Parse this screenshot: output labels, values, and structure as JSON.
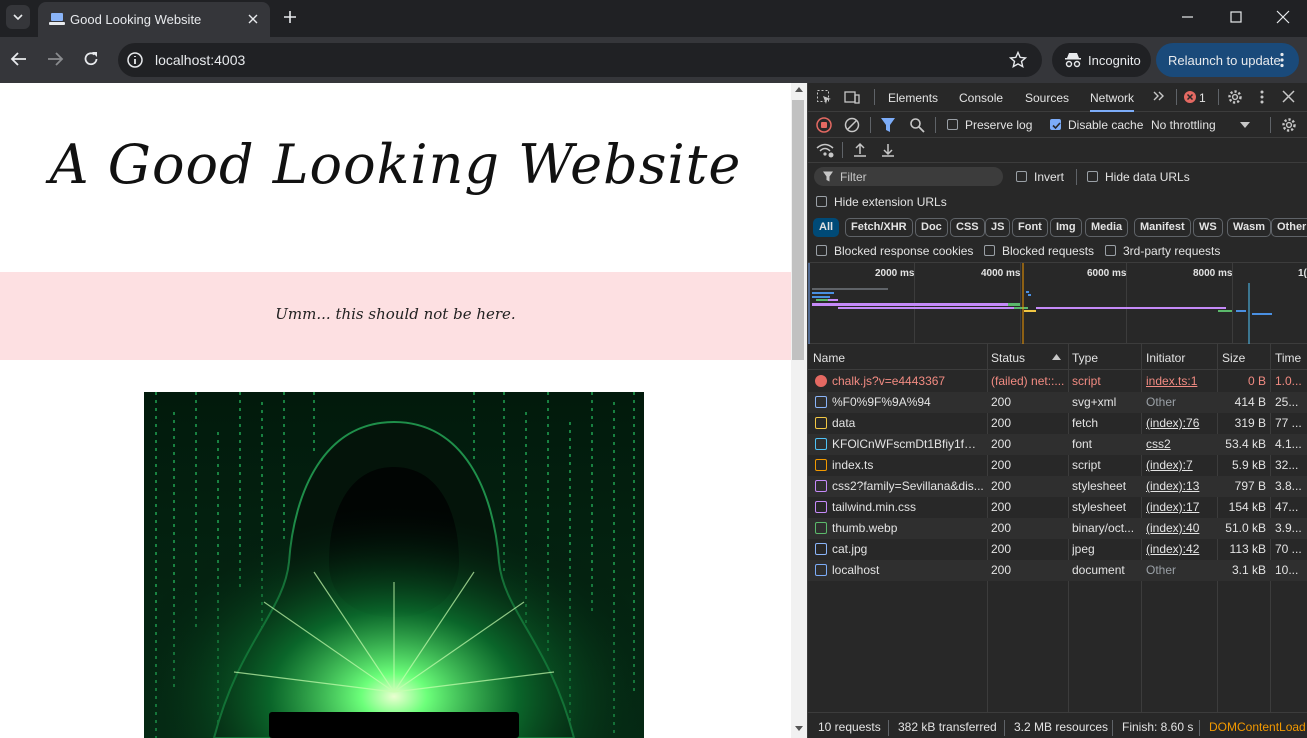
{
  "browser": {
    "tab_title": "Good Looking Website",
    "url": "localhost:4003",
    "incognito_label": "Incognito",
    "relaunch_label": "Relaunch to update"
  },
  "page": {
    "title": "A Good Looking Website",
    "notice": "Umm... this should not be here."
  },
  "devtools": {
    "tabs": [
      "Elements",
      "Console",
      "Sources",
      "Network"
    ],
    "active_tab": "Network",
    "error_count": "1",
    "preserve_log": "Preserve log",
    "disable_cache": "Disable cache",
    "throttling": "No throttling",
    "filter_placeholder": "Filter",
    "invert": "Invert",
    "hide_data_urls": "Hide data URLs",
    "hide_extension_urls": "Hide extension URLs",
    "type_filters": [
      "All",
      "Fetch/XHR",
      "Doc",
      "CSS",
      "JS",
      "Font",
      "Img",
      "Media",
      "Manifest",
      "WS",
      "Wasm",
      "Other"
    ],
    "blocked_cookies": "Blocked response cookies",
    "blocked_requests": "Blocked requests",
    "third_party": "3rd-party requests",
    "timeline_ticks": [
      "2000 ms",
      "4000 ms",
      "6000 ms",
      "8000 ms",
      "1("
    ],
    "columns": [
      "Name",
      "Status",
      "Type",
      "Initiator",
      "Size",
      "Time"
    ],
    "requests": [
      {
        "name": "chalk.js?v=e4443367",
        "status": "(failed) net::...",
        "type": "script",
        "initiator": "index.ts:1",
        "size": "0 B",
        "time": "1.0...",
        "icon": "error-icon",
        "failed": true
      },
      {
        "name": "%F0%9F%9A%94",
        "status": "200",
        "type": "svg+xml",
        "initiator": "Other",
        "size": "414 B",
        "time": "25...",
        "icon": "image-icon"
      },
      {
        "name": "data",
        "status": "200",
        "type": "fetch",
        "initiator": "(index):76",
        "size": "319 B",
        "time": "77 ...",
        "icon": "fetch-icon"
      },
      {
        "name": "KFOlCnWFscmDt1Bfiy1fBB...",
        "status": "200",
        "type": "font",
        "initiator": "css2",
        "size": "53.4 kB",
        "time": "4.1...",
        "icon": "font-icon"
      },
      {
        "name": "index.ts",
        "status": "200",
        "type": "script",
        "initiator": "(index):7",
        "size": "5.9 kB",
        "time": "32...",
        "icon": "script-icon"
      },
      {
        "name": "css2?family=Sevillana&dis...",
        "status": "200",
        "type": "stylesheet",
        "initiator": "(index):13",
        "size": "797 B",
        "time": "3.8...",
        "icon": "stylesheet-icon"
      },
      {
        "name": "tailwind.min.css",
        "status": "200",
        "type": "stylesheet",
        "initiator": "(index):17",
        "size": "154 kB",
        "time": "47...",
        "icon": "stylesheet-icon"
      },
      {
        "name": "thumb.webp",
        "status": "200",
        "type": "binary/oct...",
        "initiator": "(index):40",
        "size": "51.0 kB",
        "time": "3.9...",
        "icon": "binary-icon"
      },
      {
        "name": "cat.jpg",
        "status": "200",
        "type": "jpeg",
        "initiator": "(index):42",
        "size": "113 kB",
        "time": "70 ...",
        "icon": "image-icon"
      },
      {
        "name": "localhost",
        "status": "200",
        "type": "document",
        "initiator": "Other",
        "size": "3.1 kB",
        "time": "10...",
        "icon": "document-icon"
      }
    ],
    "summary": {
      "requests": "10 requests",
      "transferred": "382 kB transferred",
      "resources": "3.2 MB resources",
      "finish": "Finish: 8.60 s",
      "dcl": "DOMContentLoad"
    },
    "colors": {
      "accent": "#7cacf8",
      "error": "#f28b82",
      "dcl": "#f29900"
    }
  }
}
